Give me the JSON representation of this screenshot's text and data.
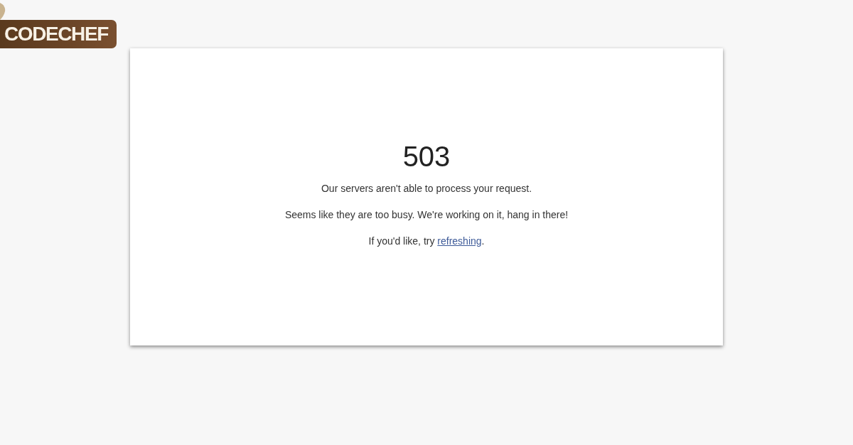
{
  "logo": {
    "text": "CODECHEF"
  },
  "error": {
    "code": "503",
    "lines": [
      "Our servers aren't able to process your request.",
      "Seems like they are too busy. We're working on it, hang in there!"
    ],
    "retry": {
      "text": "If you'd like, try ",
      "link": "refreshing",
      "after": "."
    }
  }
}
